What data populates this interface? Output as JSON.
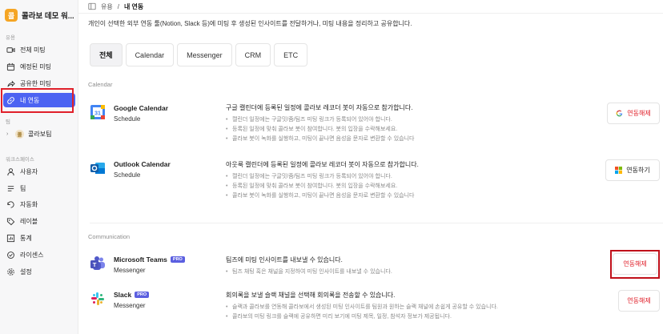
{
  "workspace": {
    "logo_char": "콜",
    "name": "콜라보 데모 워..."
  },
  "sidebar": {
    "section_apps": "유용",
    "items": [
      {
        "label": "전체 미팅",
        "icon": "video-icon"
      },
      {
        "label": "예정된 미팅",
        "icon": "calendar-icon"
      },
      {
        "label": "공유한 미팅",
        "icon": "share-icon"
      },
      {
        "label": "내 연동",
        "icon": "link-icon",
        "active": true
      }
    ],
    "section_team": "팀",
    "team": {
      "badge": "콜",
      "label": "콜라보팀"
    },
    "section_workspace": "워크스페이스",
    "ws_items": [
      {
        "label": "사용자",
        "icon": "user-icon"
      },
      {
        "label": "팀",
        "icon": "team-list-icon"
      },
      {
        "label": "자동화",
        "icon": "automation-icon"
      },
      {
        "label": "레이블",
        "icon": "tag-icon"
      },
      {
        "label": "통계",
        "icon": "chart-icon"
      },
      {
        "label": "라이센스",
        "icon": "license-icon"
      },
      {
        "label": "설정",
        "icon": "gear-icon"
      }
    ]
  },
  "breadcrumb": {
    "parent": "유용",
    "separator": "/",
    "current": "내 연동"
  },
  "description": "개인이 선택한 외부 연동 툴(Notion, Slack 등)에 미팅 후 생성된 인사이트를 전달하거나, 미팅 내용을 정리하고 공유합니다.",
  "tabs": [
    "전체",
    "Calendar",
    "Messenger",
    "CRM",
    "ETC"
  ],
  "categories": {
    "calendar": "Calendar",
    "communication": "Communication"
  },
  "apps": {
    "google": {
      "name": "Google Calendar",
      "type": "Schedule",
      "title": "구글 캘린더에 등록된 일정에 콜라보 레코더 봇이 자동으로 참가합니다.",
      "bullets": [
        "캘린더 일정에는 구글밋/줌/팀즈 미팅 링크가 등록되어 있어야 합니다.",
        "등록된 일정에 맞춰 콜라보 봇이 참여합니다. 봇의 입장을 수락해보세요.",
        "콜라보 봇이 녹화를 실행하고, 미팅이 끝나면 음성을 문자로 변환할 수 있습니다"
      ],
      "button": "연동해제"
    },
    "outlook": {
      "name": "Outlook Calendar",
      "type": "Schedule",
      "title": "아웃룩 캘린더에 등록된 일정에 콜라보 레코더 봇이 자동으로 참가합니다.",
      "bullets": [
        "캘린더 일정에는 구글밋/줌/팀즈 미팅 링크가 등록되어 있어야 합니다.",
        "등록된 일정에 맞춰 콜라보 봇이 참여합니다. 봇의 입장을 수락해보세요.",
        "콜라보 봇이 녹화를 실행하고, 미팅이 끝나면 음성을 문자로 변환할 수 있습니다"
      ],
      "button": "연동하기"
    },
    "teams": {
      "name": "Microsoft Teams",
      "badge": "PRO",
      "type": "Messenger",
      "title": "팀즈에 미팅 인사이트를 내보낼 수 있습니다.",
      "bullets": [
        "팀즈 채팅 혹은 채널을 지정하여 미팅 인사이트를 내보낼 수 있습니다."
      ],
      "button": "연동해제"
    },
    "slack": {
      "name": "Slack",
      "badge": "PRO",
      "type": "Messenger",
      "title": "회의록을 보낼 슬랙 채널을 선택해 회의록을 전송할 수 있습니다.",
      "bullets": [
        "슬랙과 콜라보를 연동해 콜라보에서 생성된 미팅 인사이트를 팀원과 원하는 슬랙 채널에 손쉽게 공유할 수 있습니다.",
        "콜라보의 미팅 링크를 슬랙에 공유하면 미리 보기에 미팅 제목, 일정, 참석자 정보가 제공됩니다."
      ],
      "button": "연동해제"
    }
  },
  "colors": {
    "accent": "#4c63f2",
    "danger": "#e0202a",
    "pro_badge": "#5b5fe0"
  }
}
